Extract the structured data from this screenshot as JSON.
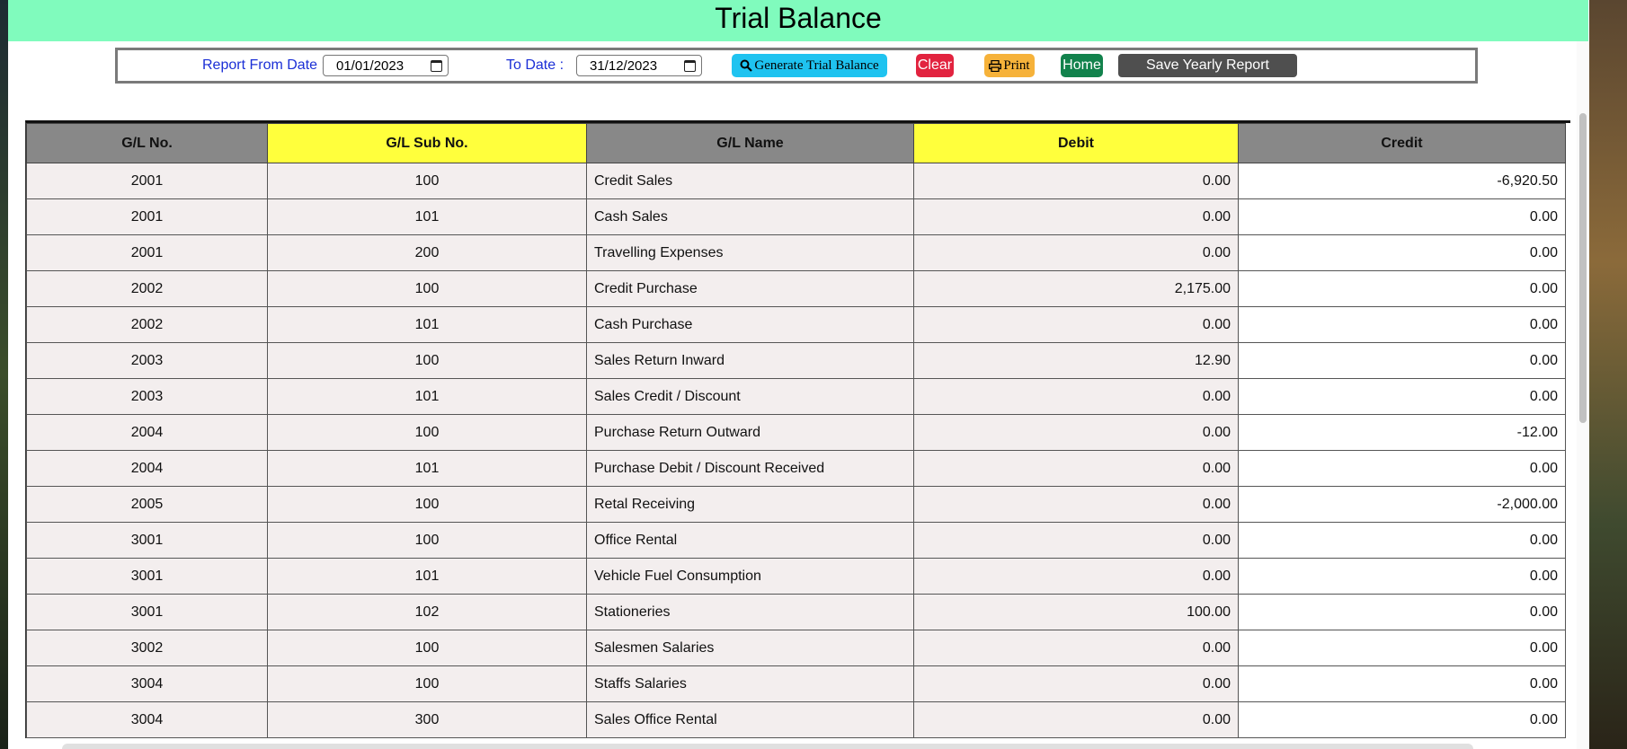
{
  "page": {
    "title": "Trial Balance"
  },
  "controls": {
    "from_label": "Report From Date :",
    "from_value": "01/01/2023",
    "to_label": "To Date :",
    "to_value": "31/12/2023",
    "generate_label": "Generate Trial Balance",
    "clear_label": "Clear",
    "print_label": "Print",
    "home_label": "Home",
    "save_label": "Save Yearly Report"
  },
  "colors": {
    "title_bg": "#80fbbd",
    "header_gray": "#888888",
    "header_yellow": "#ffff3c",
    "generate_btn": "#1fc3f0",
    "clear_btn": "#e2233f",
    "print_btn": "#f6b23a",
    "home_btn": "#12824c",
    "save_btn": "#4f4f4f"
  },
  "table": {
    "headers": [
      "G/L No.",
      "G/L Sub No.",
      "G/L Name",
      "Debit",
      "Credit"
    ],
    "rows": [
      [
        "2001",
        "100",
        "Credit Sales",
        "0.00",
        "-6,920.50"
      ],
      [
        "2001",
        "101",
        "Cash Sales",
        "0.00",
        "0.00"
      ],
      [
        "2001",
        "200",
        "Travelling Expenses",
        "0.00",
        "0.00"
      ],
      [
        "2002",
        "100",
        "Credit Purchase",
        "2,175.00",
        "0.00"
      ],
      [
        "2002",
        "101",
        "Cash Purchase",
        "0.00",
        "0.00"
      ],
      [
        "2003",
        "100",
        "Sales Return Inward",
        "12.90",
        "0.00"
      ],
      [
        "2003",
        "101",
        "Sales Credit / Discount",
        "0.00",
        "0.00"
      ],
      [
        "2004",
        "100",
        "Purchase Return Outward",
        "0.00",
        "-12.00"
      ],
      [
        "2004",
        "101",
        "Purchase Debit / Discount Received",
        "0.00",
        "0.00"
      ],
      [
        "2005",
        "100",
        "Retal Receiving",
        "0.00",
        "-2,000.00"
      ],
      [
        "3001",
        "100",
        "Office Rental",
        "0.00",
        "0.00"
      ],
      [
        "3001",
        "101",
        "Vehicle Fuel Consumption",
        "0.00",
        "0.00"
      ],
      [
        "3001",
        "102",
        "Stationeries",
        "100.00",
        "0.00"
      ],
      [
        "3002",
        "100",
        "Salesmen Salaries",
        "0.00",
        "0.00"
      ],
      [
        "3004",
        "100",
        "Staffs Salaries",
        "0.00",
        "0.00"
      ],
      [
        "3004",
        "300",
        "Sales Office Rental",
        "0.00",
        "0.00"
      ]
    ]
  }
}
